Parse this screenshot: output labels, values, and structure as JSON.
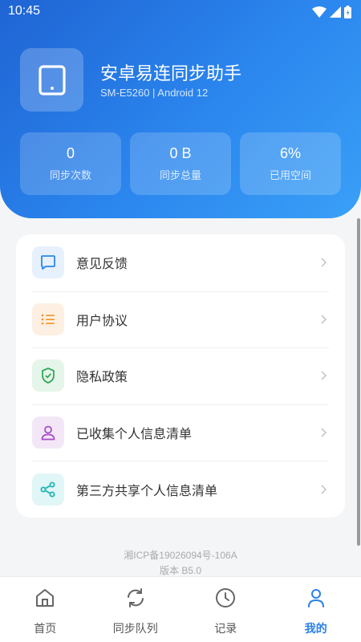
{
  "status_bar": {
    "time": "10:45"
  },
  "device": {
    "title": "安卓易连同步助手",
    "subtitle": "SM-E5260 | Android 12"
  },
  "stats": [
    {
      "value": "0",
      "label": "同步次数"
    },
    {
      "value": "0 B",
      "label": "同步总量"
    },
    {
      "value": "6%",
      "label": "已用空间"
    }
  ],
  "menu": [
    {
      "label": "意见反馈",
      "icon": "feedback-icon",
      "icon_bg": "#e6f1fd",
      "icon_color": "#2c86e8"
    },
    {
      "label": "用户协议",
      "icon": "list-icon",
      "icon_bg": "#fdf0e2",
      "icon_color": "#f0932b"
    },
    {
      "label": "隐私政策",
      "icon": "shield-check-icon",
      "icon_bg": "#e5f5ea",
      "icon_color": "#35a85a"
    },
    {
      "label": "已收集个人信息清单",
      "icon": "user-icon",
      "icon_bg": "#f3e7f7",
      "icon_color": "#a94cc8"
    },
    {
      "label": "第三方共享个人信息清单",
      "icon": "share-icon",
      "icon_bg": "#e1f6f6",
      "icon_color": "#1fb5b5"
    }
  ],
  "footer": {
    "icp": "湘ICP备19026094号-106A",
    "version": "版本 B5.0"
  },
  "nav": [
    {
      "label": "首页",
      "icon": "home-icon",
      "active": false
    },
    {
      "label": "同步队列",
      "icon": "sync-icon",
      "active": false
    },
    {
      "label": "记录",
      "icon": "clock-icon",
      "active": false
    },
    {
      "label": "我的",
      "icon": "person-icon",
      "active": true
    }
  ],
  "colors": {
    "accent": "#2a80ea",
    "header_start": "#1f64d4",
    "header_end": "#3aa0f7"
  }
}
